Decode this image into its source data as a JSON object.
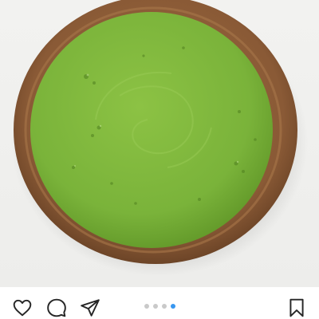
{
  "post": {
    "image": {
      "subject": "green-puree-in-wooden-bowl",
      "colors": {
        "bowl_wood": "#8a5a36",
        "bowl_wood_dark": "#5e3a20",
        "puree_green": "#7ab33a",
        "puree_dark": "#5f9527",
        "background": "#efefed"
      }
    },
    "carousel": {
      "total_slides": 4,
      "active_index": 3,
      "active_color": "#3897f0",
      "inactive_color": "#c9c9c9"
    },
    "actions": {
      "like_icon": "heart-icon",
      "comment_icon": "comment-icon",
      "share_icon": "paper-plane-icon",
      "save_icon": "bookmark-icon"
    }
  }
}
